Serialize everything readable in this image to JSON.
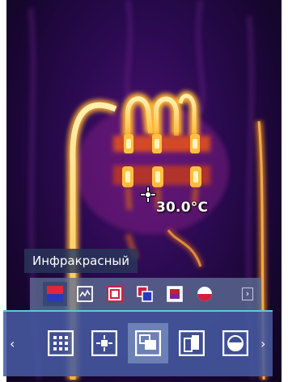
{
  "reading": {
    "temperature": "30.0°C"
  },
  "palette_bar": {
    "label": "Инфракрасный",
    "palettes": [
      {
        "name": "ironbow-palette",
        "selected": true
      },
      {
        "name": "graph-palette",
        "selected": false
      },
      {
        "name": "red-frame-palette",
        "selected": false
      },
      {
        "name": "overlap-palette",
        "selected": false
      },
      {
        "name": "rainbow-palette",
        "selected": false
      },
      {
        "name": "half-circle-palette",
        "selected": false
      }
    ],
    "more_icon": "chevron-right-icon"
  },
  "view_bar": {
    "prev": "‹",
    "next": "›",
    "modes": [
      "grid-view",
      "center-spot-view",
      "picture-in-picture-view",
      "split-view",
      "fusion-view"
    ],
    "selected_mode": "picture-in-picture-view"
  },
  "colors": {
    "accent": "#5fc8d8",
    "hot_white": "#fff8d8",
    "hot_yellow": "#ffd040",
    "warm_orange": "#e05020",
    "cool_purple": "#2a0a50"
  }
}
